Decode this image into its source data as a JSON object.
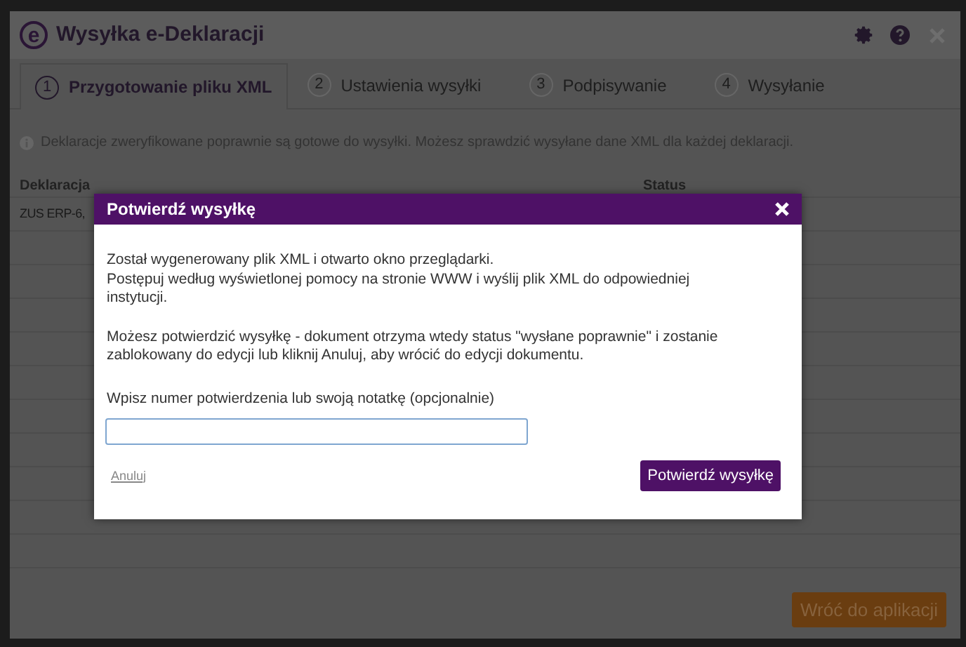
{
  "window": {
    "title": "Wysyłka e-Deklaracji",
    "logo": "e"
  },
  "tabs": [
    {
      "number": "1",
      "label": "Przygotowanie pliku XML",
      "selected": true
    },
    {
      "number": "2",
      "label": "Ustawienia wysyłki",
      "selected": false
    },
    {
      "number": "3",
      "label": "Podpisywanie",
      "selected": false
    },
    {
      "number": "4",
      "label": "Wysyłanie",
      "selected": false
    }
  ],
  "info": "Deklaracje zweryfikowane poprawnie są gotowe do wysyłki. Możesz sprawdzić wysyłane dane XML dla każdej deklaracji.",
  "table": {
    "columns": [
      "Deklaracja",
      "Status"
    ],
    "rows": [
      {
        "column_1": "ZUS ERP-6,"
      }
    ]
  },
  "dialog": {
    "title": "Potwierdź wysyłkę",
    "paragraphs": [
      [
        "Został wygenerowany plik XML i otwarto okno przeglądarki.",
        "Postępuj według wyświetlonej pomocy na stronie WWW i wyślij plik XML do odpowiedniej instytucji."
      ],
      [
        "Możesz potwierdzić wysyłkę - dokument otrzyma wtedy status \"wysłane poprawnie\" i zostanie zablokowany do edycji lub kliknij Anuluj, aby wrócić do edycji dokumentu."
      ]
    ],
    "field_label": "Wpisz numer potwierdzenia lub swoją notatkę (opcjonalnie)",
    "cancel": "Anuluj",
    "confirm": "Potwierdź wysyłkę"
  },
  "footer_button": "Wróć do aplikacji"
}
